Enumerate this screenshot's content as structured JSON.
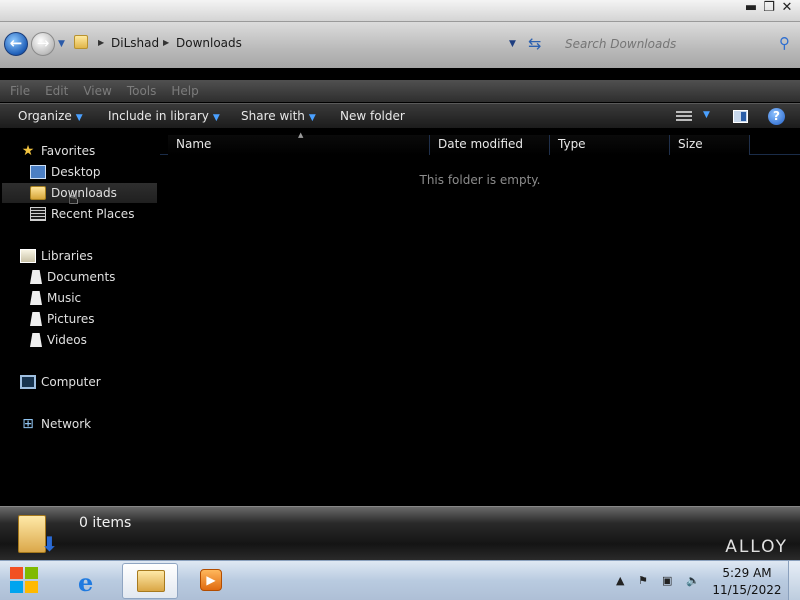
{
  "window": {
    "controls": {
      "minimize": "▬",
      "maximize": "❐",
      "close": "✕"
    }
  },
  "addressbar": {
    "breadcrumb": [
      "DiLshad",
      "Downloads"
    ],
    "search_placeholder": "Search Downloads"
  },
  "menubar": {
    "items": [
      "File",
      "Edit",
      "View",
      "Tools",
      "Help"
    ]
  },
  "toolbar": {
    "organize": "Organize",
    "include_in_library": "Include in library",
    "share_with": "Share with",
    "new_folder": "New folder",
    "help": "?"
  },
  "navpane": {
    "favorites": {
      "label": "Favorites",
      "items": [
        "Desktop",
        "Downloads",
        "Recent Places"
      ]
    },
    "libraries": {
      "label": "Libraries",
      "items": [
        "Documents",
        "Music",
        "Pictures",
        "Videos"
      ]
    },
    "computer": "Computer",
    "network": "Network",
    "selected": "Downloads"
  },
  "content": {
    "columns": [
      "Name",
      "Date modified",
      "Type",
      "Size"
    ],
    "empty_message": "This folder is empty."
  },
  "details": {
    "item_count": "0 items",
    "brand": "ALLOY"
  },
  "taskbar": {
    "time": "5:29 AM",
    "date": "11/15/2022"
  },
  "colors": {
    "accent": "#4aa0ff",
    "background": "#000000",
    "taskbar": "#b9cbe0"
  }
}
